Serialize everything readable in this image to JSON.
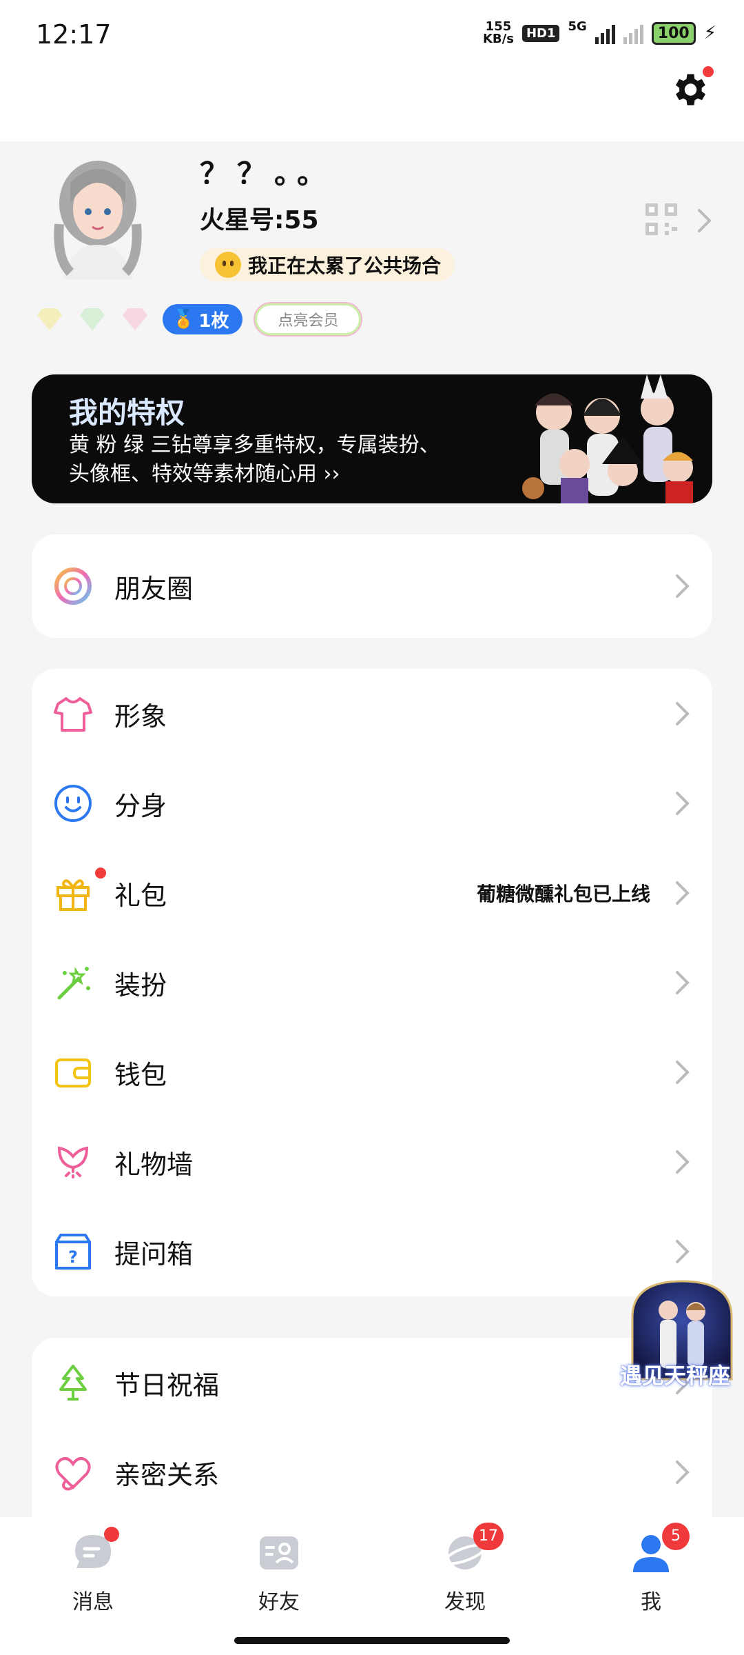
{
  "status_bar": {
    "time": "12:17",
    "net_speed": "155",
    "net_unit": "KB/s",
    "hd": "HD1",
    "network": "5G",
    "battery": "100"
  },
  "profile": {
    "name": "？？。。",
    "id": "火星号:55",
    "status": "我正在太累了公共场合"
  },
  "badges": {
    "medal": "1枚",
    "vip": "点亮会员"
  },
  "banner": {
    "title": "我的特权",
    "desc": "黄 粉 绿 三钻尊享多重特权，专属装扮、头像框、特效等素材随心用 ››"
  },
  "card1": [
    {
      "label": "朋友圈",
      "icon": "moments-ring-icon"
    }
  ],
  "card2": [
    {
      "label": "形象",
      "icon": "shirt-icon",
      "extra": ""
    },
    {
      "label": "分身",
      "icon": "smiley-icon",
      "extra": ""
    },
    {
      "label": "礼包",
      "icon": "gift-icon",
      "extra": "葡糖微醺礼包已上线"
    },
    {
      "label": "装扮",
      "icon": "magic-wand-icon",
      "extra": ""
    },
    {
      "label": "钱包",
      "icon": "wallet-icon",
      "extra": ""
    },
    {
      "label": "礼物墙",
      "icon": "tulip-icon",
      "extra": ""
    },
    {
      "label": "提问箱",
      "icon": "question-box-icon",
      "extra": ""
    }
  ],
  "card3": [
    {
      "label": "节日祝福",
      "icon": "christmas-tree-icon"
    },
    {
      "label": "亲密关系",
      "icon": "heart-link-icon"
    }
  ],
  "floating": {
    "text": "遇见天秤座"
  },
  "bottom_nav": [
    {
      "label": "消息",
      "badge": ""
    },
    {
      "label": "好友",
      "badge": ""
    },
    {
      "label": "发现",
      "badge": "17"
    },
    {
      "label": "我",
      "badge": "5"
    }
  ],
  "colors": {
    "accent_blue": "#2c78f0",
    "badge_red": "#f0393b",
    "banner_bg": "#0b0b0b"
  }
}
